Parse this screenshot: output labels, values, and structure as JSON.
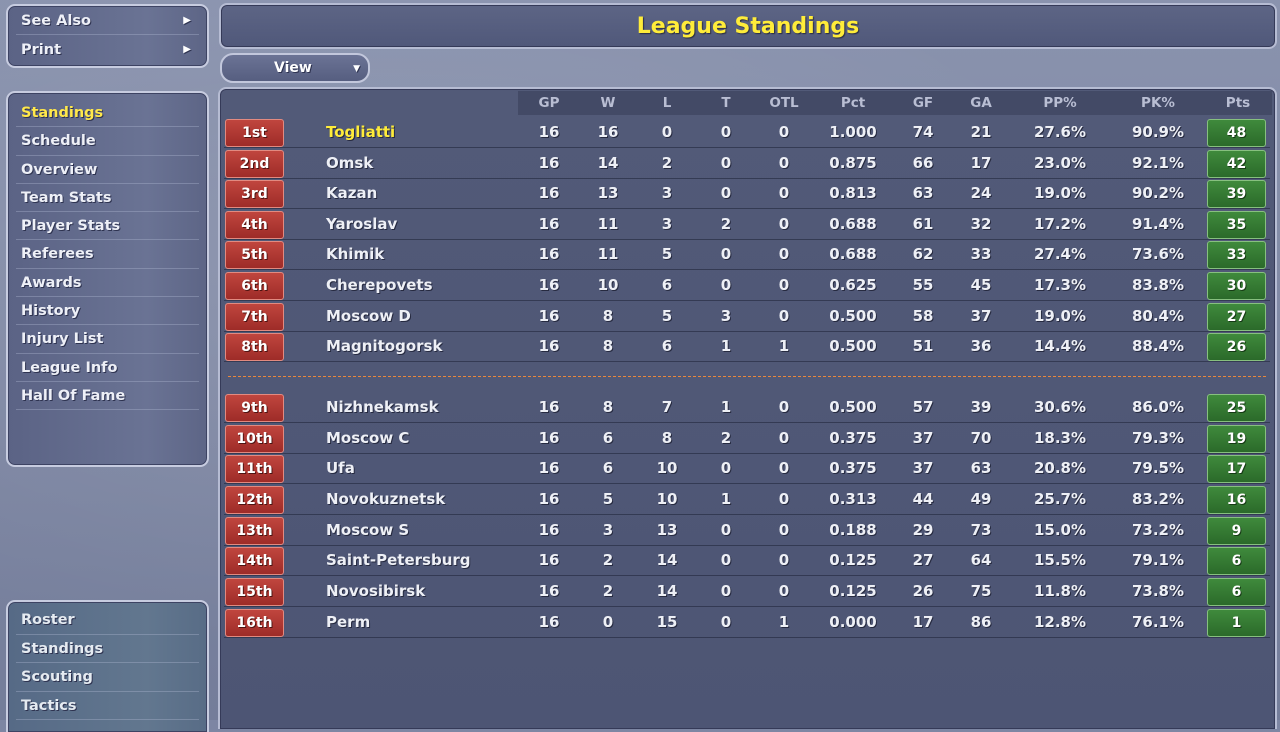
{
  "top_menu": [
    {
      "label": "See Also"
    },
    {
      "label": "Print"
    }
  ],
  "nav": [
    {
      "label": "Standings",
      "active": true
    },
    {
      "label": "Schedule"
    },
    {
      "label": "Overview"
    },
    {
      "label": "Team Stats"
    },
    {
      "label": "Player Stats"
    },
    {
      "label": "Referees"
    },
    {
      "label": "Awards"
    },
    {
      "label": "History"
    },
    {
      "label": "Injury List"
    },
    {
      "label": "League Info"
    },
    {
      "label": "Hall Of Fame"
    }
  ],
  "bottom_nav": [
    {
      "label": "Roster"
    },
    {
      "label": "Standings"
    },
    {
      "label": "Scouting"
    },
    {
      "label": "Tactics"
    }
  ],
  "title": "League Standings",
  "view_label": "View",
  "columns": [
    "GP",
    "W",
    "L",
    "T",
    "OTL",
    "Pct",
    "GF",
    "GA",
    "PP%",
    "PK%",
    "Pts"
  ],
  "rows": [
    {
      "rank": "1st",
      "team": "Togliatti",
      "highlight": true,
      "GP": "16",
      "W": "16",
      "L": "0",
      "T": "0",
      "OTL": "0",
      "Pct": "1.000",
      "GF": "74",
      "GA": "21",
      "PP": "27.6%",
      "PK": "90.9%",
      "Pts": "48"
    },
    {
      "rank": "2nd",
      "team": "Omsk",
      "GP": "16",
      "W": "14",
      "L": "2",
      "T": "0",
      "OTL": "0",
      "Pct": "0.875",
      "GF": "66",
      "GA": "17",
      "PP": "23.0%",
      "PK": "92.1%",
      "Pts": "42"
    },
    {
      "rank": "3rd",
      "team": "Kazan",
      "GP": "16",
      "W": "13",
      "L": "3",
      "T": "0",
      "OTL": "0",
      "Pct": "0.813",
      "GF": "63",
      "GA": "24",
      "PP": "19.0%",
      "PK": "90.2%",
      "Pts": "39"
    },
    {
      "rank": "4th",
      "team": "Yaroslav",
      "GP": "16",
      "W": "11",
      "L": "3",
      "T": "2",
      "OTL": "0",
      "Pct": "0.688",
      "GF": "61",
      "GA": "32",
      "PP": "17.2%",
      "PK": "91.4%",
      "Pts": "35"
    },
    {
      "rank": "5th",
      "team": "Khimik",
      "GP": "16",
      "W": "11",
      "L": "5",
      "T": "0",
      "OTL": "0",
      "Pct": "0.688",
      "GF": "62",
      "GA": "33",
      "PP": "27.4%",
      "PK": "73.6%",
      "Pts": "33"
    },
    {
      "rank": "6th",
      "team": "Cherepovets",
      "GP": "16",
      "W": "10",
      "L": "6",
      "T": "0",
      "OTL": "0",
      "Pct": "0.625",
      "GF": "55",
      "GA": "45",
      "PP": "17.3%",
      "PK": "83.8%",
      "Pts": "30"
    },
    {
      "rank": "7th",
      "team": "Moscow D",
      "GP": "16",
      "W": "8",
      "L": "5",
      "T": "3",
      "OTL": "0",
      "Pct": "0.500",
      "GF": "58",
      "GA": "37",
      "PP": "19.0%",
      "PK": "80.4%",
      "Pts": "27"
    },
    {
      "rank": "8th",
      "team": "Magnitogorsk",
      "GP": "16",
      "W": "8",
      "L": "6",
      "T": "1",
      "OTL": "1",
      "Pct": "0.500",
      "GF": "51",
      "GA": "36",
      "PP": "14.4%",
      "PK": "88.4%",
      "Pts": "26"
    },
    {
      "rank": "9th",
      "team": "Nizhnekamsk",
      "GP": "16",
      "W": "8",
      "L": "7",
      "T": "1",
      "OTL": "0",
      "Pct": "0.500",
      "GF": "57",
      "GA": "39",
      "PP": "30.6%",
      "PK": "86.0%",
      "Pts": "25"
    },
    {
      "rank": "10th",
      "team": "Moscow C",
      "GP": "16",
      "W": "6",
      "L": "8",
      "T": "2",
      "OTL": "0",
      "Pct": "0.375",
      "GF": "37",
      "GA": "70",
      "PP": "18.3%",
      "PK": "79.3%",
      "Pts": "19"
    },
    {
      "rank": "11th",
      "team": "Ufa",
      "GP": "16",
      "W": "6",
      "L": "10",
      "T": "0",
      "OTL": "0",
      "Pct": "0.375",
      "GF": "37",
      "GA": "63",
      "PP": "20.8%",
      "PK": "79.5%",
      "Pts": "17"
    },
    {
      "rank": "12th",
      "team": "Novokuznetsk",
      "GP": "16",
      "W": "5",
      "L": "10",
      "T": "1",
      "OTL": "0",
      "Pct": "0.313",
      "GF": "44",
      "GA": "49",
      "PP": "25.7%",
      "PK": "83.2%",
      "Pts": "16"
    },
    {
      "rank": "13th",
      "team": "Moscow S",
      "GP": "16",
      "W": "3",
      "L": "13",
      "T": "0",
      "OTL": "0",
      "Pct": "0.188",
      "GF": "29",
      "GA": "73",
      "PP": "15.0%",
      "PK": "73.2%",
      "Pts": "9"
    },
    {
      "rank": "14th",
      "team": "Saint-Petersburg",
      "GP": "16",
      "W": "2",
      "L": "14",
      "T": "0",
      "OTL": "0",
      "Pct": "0.125",
      "GF": "27",
      "GA": "64",
      "PP": "15.5%",
      "PK": "79.1%",
      "Pts": "6"
    },
    {
      "rank": "15th",
      "team": "Novosibirsk",
      "GP": "16",
      "W": "2",
      "L": "14",
      "T": "0",
      "OTL": "0",
      "Pct": "0.125",
      "GF": "26",
      "GA": "75",
      "PP": "11.8%",
      "PK": "73.8%",
      "Pts": "6"
    },
    {
      "rank": "16th",
      "team": "Perm",
      "GP": "16",
      "W": "0",
      "L": "15",
      "T": "0",
      "OTL": "1",
      "Pct": "0.000",
      "GF": "17",
      "GA": "86",
      "PP": "12.8%",
      "PK": "76.1%",
      "Pts": "1"
    }
  ],
  "colors": {
    "title_yellow": "#ffec3a",
    "rank_red": "#b03a34",
    "points_green": "#347a33",
    "playoff_cutoff_orange": "#e9873b"
  },
  "icons": {
    "submenu_arrow": "chevron-right-icon",
    "dropdown_caret": "chevron-down-icon"
  }
}
